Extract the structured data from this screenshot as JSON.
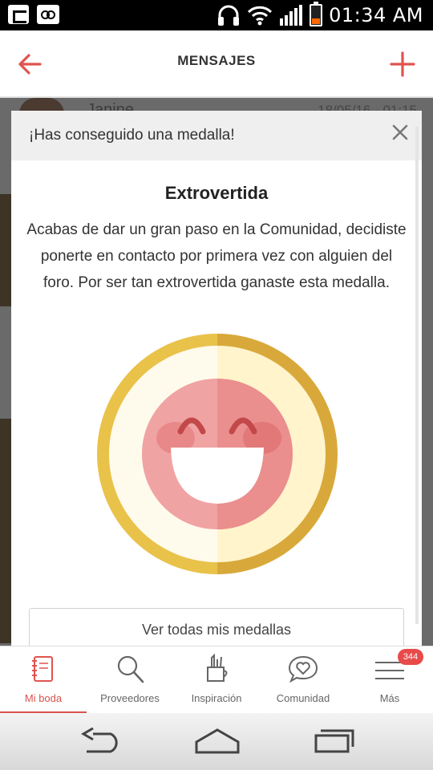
{
  "status_bar": {
    "time": "01:34 AM",
    "icons": [
      "bbm-icon",
      "voicemail-icon",
      "headset-icon",
      "wifi-icon",
      "signal-icon",
      "battery-icon"
    ],
    "battery_color": "#ff6a00"
  },
  "header": {
    "title": "MENSAJES",
    "accent_color": "#e0534f"
  },
  "background_list": {
    "first_item_name": "Janine",
    "first_item_date": "18/05/16 - 01:15"
  },
  "modal": {
    "title": "¡Has conseguido una medalla!",
    "badge_name": "Extrovertida",
    "description": "Acabas de dar un gran paso en la Comunidad, decidiste ponerte en contacto por primera vez con alguien del foro. Por ser tan extrovertida ganaste esta medalla.",
    "button_label": "Ver todas mis medallas",
    "medal_icon": "smiley-medal-icon"
  },
  "bottom_nav": {
    "items": [
      {
        "label": "Mi boda",
        "icon": "notebook-icon"
      },
      {
        "label": "Proveedores",
        "icon": "search-icon"
      },
      {
        "label": "Inspiración",
        "icon": "pencil-cup-icon"
      },
      {
        "label": "Comunidad",
        "icon": "heart-chat-icon"
      },
      {
        "label": "Más",
        "icon": "menu-icon"
      }
    ],
    "active_index": 0,
    "more_badge": "344"
  }
}
